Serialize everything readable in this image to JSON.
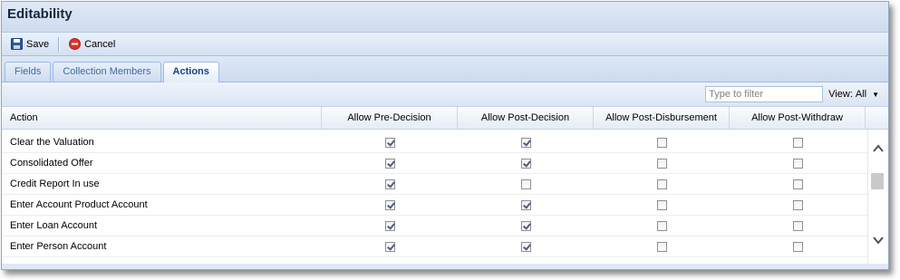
{
  "window": {
    "title": "Editability"
  },
  "toolbar": {
    "save_label": "Save",
    "cancel_label": "Cancel"
  },
  "tabs": [
    {
      "label": "Fields",
      "active": false
    },
    {
      "label": "Collection Members",
      "active": false
    },
    {
      "label": "Actions",
      "active": true
    }
  ],
  "filter": {
    "placeholder": "Type to filter",
    "view_label": "View:",
    "view_value": "All"
  },
  "grid": {
    "columns": [
      "Action",
      "Allow Pre-Decision",
      "Allow Post-Decision",
      "Allow Post-Disbursement",
      "Allow Post-Withdraw"
    ],
    "rows": [
      {
        "action": "Clear the Valuation",
        "flags": [
          true,
          true,
          false,
          false
        ]
      },
      {
        "action": "Consolidated Offer",
        "flags": [
          true,
          true,
          false,
          false
        ]
      },
      {
        "action": "Credit Report In use",
        "flags": [
          true,
          false,
          false,
          false
        ]
      },
      {
        "action": "Enter Account Product Account",
        "flags": [
          true,
          true,
          false,
          false
        ]
      },
      {
        "action": "Enter Loan Account",
        "flags": [
          true,
          true,
          false,
          false
        ]
      },
      {
        "action": "Enter Person Account",
        "flags": [
          true,
          true,
          false,
          false
        ]
      }
    ]
  },
  "icons": {
    "save": "floppy-disk-icon",
    "cancel": "cancel-circle-icon",
    "scroll_up": "chevron-up-icon",
    "scroll_down": "chevron-down-icon",
    "view_dropdown": "caret-down-icon"
  },
  "colors": {
    "accent": "#15428b",
    "cancel_red": "#d9342b",
    "panel_bg": "#dfe8f6"
  }
}
